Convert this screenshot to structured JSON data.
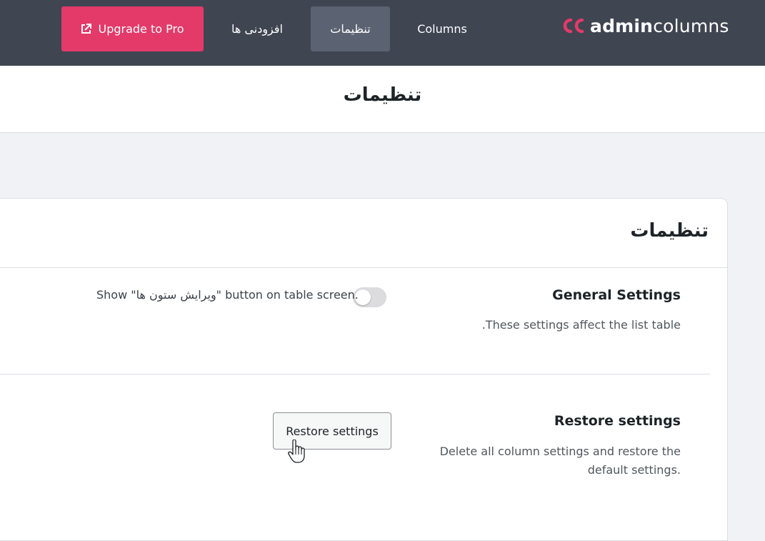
{
  "header": {
    "logo": {
      "brand_bold": "admin",
      "brand_light": "columns"
    },
    "nav": {
      "columns_label": "Columns",
      "settings_label": "تنظیمات",
      "addons_label": "افزودنی ها",
      "upgrade_label": "Upgrade to Pro"
    },
    "colors": {
      "topbar": "#3f4551",
      "active_tab": "#5b6271",
      "upgrade": "#e33a6a"
    }
  },
  "page": {
    "title": "تنظیمات"
  },
  "card": {
    "title": "تنظیمات",
    "general": {
      "label": "General Settings",
      "description": ".These settings affect the list table",
      "toggle_text": "Show \"ویرایش ستون ها\" button on table screen.",
      "toggle_on": false
    },
    "restore": {
      "label": "Restore settings",
      "description": "Delete all column settings and restore the default settings.",
      "button_label": "Restore settings"
    }
  }
}
